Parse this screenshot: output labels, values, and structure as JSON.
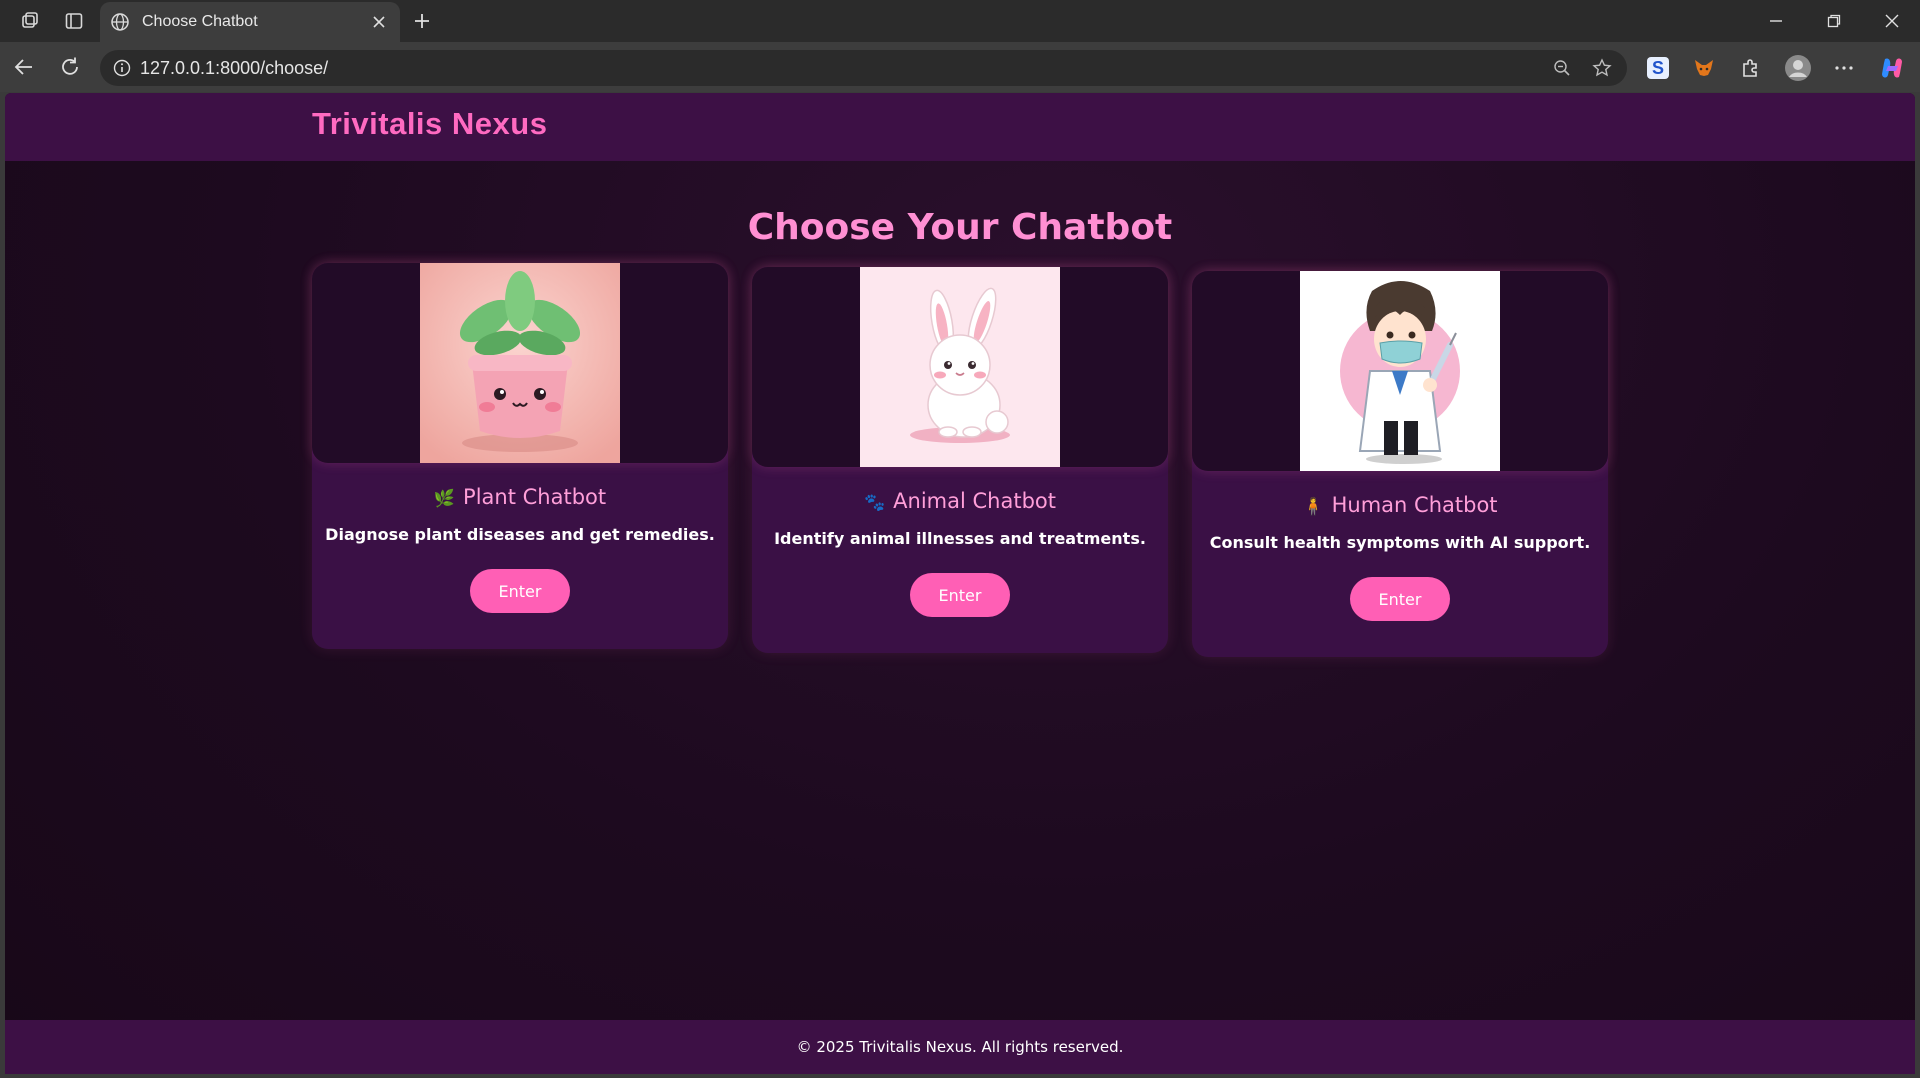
{
  "browser": {
    "tab_title": "Choose Chatbot",
    "url": "127.0.0.1:8000/choose/"
  },
  "site": {
    "brand": "Trivitalis Nexus",
    "page_title": "Choose Your Chatbot",
    "accent_color": "#ff5fb5",
    "header_color": "#3d1045",
    "background_color": "#1d0a1f"
  },
  "cards": [
    {
      "emoji": "🌿",
      "title": "Plant Chatbot",
      "description": "Diagnose plant diseases and get remedies.",
      "button": "Enter",
      "image": "potted-plant-illustration"
    },
    {
      "emoji": "🐾",
      "title": "Animal Chatbot",
      "description": "Identify animal illnesses and treatments.",
      "button": "Enter",
      "image": "bunny-illustration"
    },
    {
      "emoji": "🧍",
      "title": "Human Chatbot",
      "description": "Consult health symptoms with AI support.",
      "button": "Enter",
      "image": "doctor-illustration"
    }
  ],
  "footer": {
    "text": "© 2025 Trivitalis Nexus. All rights reserved."
  }
}
